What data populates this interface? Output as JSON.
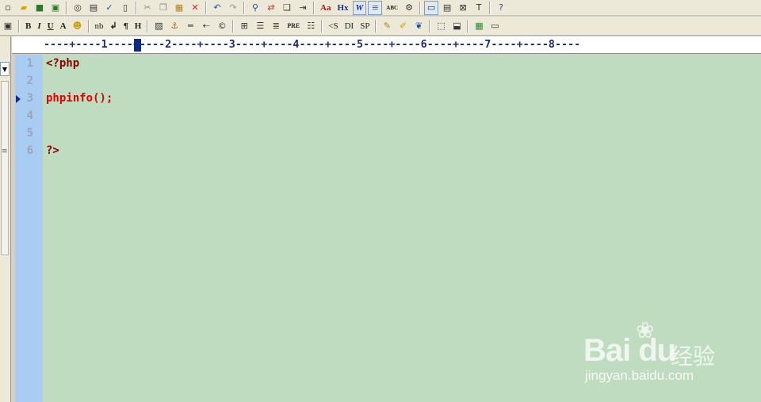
{
  "toolbar1": {
    "icons": [
      "new-icon",
      "open-icon",
      "save-icon",
      "save-all-icon",
      "print-preview-icon",
      "print-icon",
      "spellcheck-icon",
      "page-icon",
      "cut-icon",
      "copy-icon",
      "paste-icon",
      "delete-icon",
      "undo-icon",
      "redo-icon",
      "find-icon",
      "replace-icon",
      "find-in-files-icon",
      "goto-icon"
    ],
    "font_label": "Aa",
    "hx_label": "Hx",
    "word_wrap_label": "W",
    "abc_label": "ABC"
  },
  "toolbar2": {
    "bold": "B",
    "italic": "I",
    "underline": "U",
    "font_a": "A",
    "nbsp": "nb",
    "break": "↲",
    "para": "¶",
    "heading": "H",
    "pre": "PRE",
    "s_tag": "<S",
    "di_tag": "DI",
    "sp_tag": "SP"
  },
  "ruler": {
    "text": "----+----1----+----2----+----3----+----4----+----5----+----6----+----7----+----8----"
  },
  "editor": {
    "line_numbers": [
      "1",
      "2",
      "3",
      "4",
      "5",
      "6"
    ],
    "lines": [
      "<?php",
      "",
      "phpinfo();",
      "",
      "",
      "?>"
    ]
  },
  "watermark": {
    "logo": "Bai du",
    "cn": "经验",
    "url": "jingyan.baidu.com"
  },
  "colors": {
    "editor_bg": "#c0dcc0",
    "gutter_bg": "#a9cdf2",
    "php_tag": "#8b0000",
    "function": "#e00000"
  }
}
